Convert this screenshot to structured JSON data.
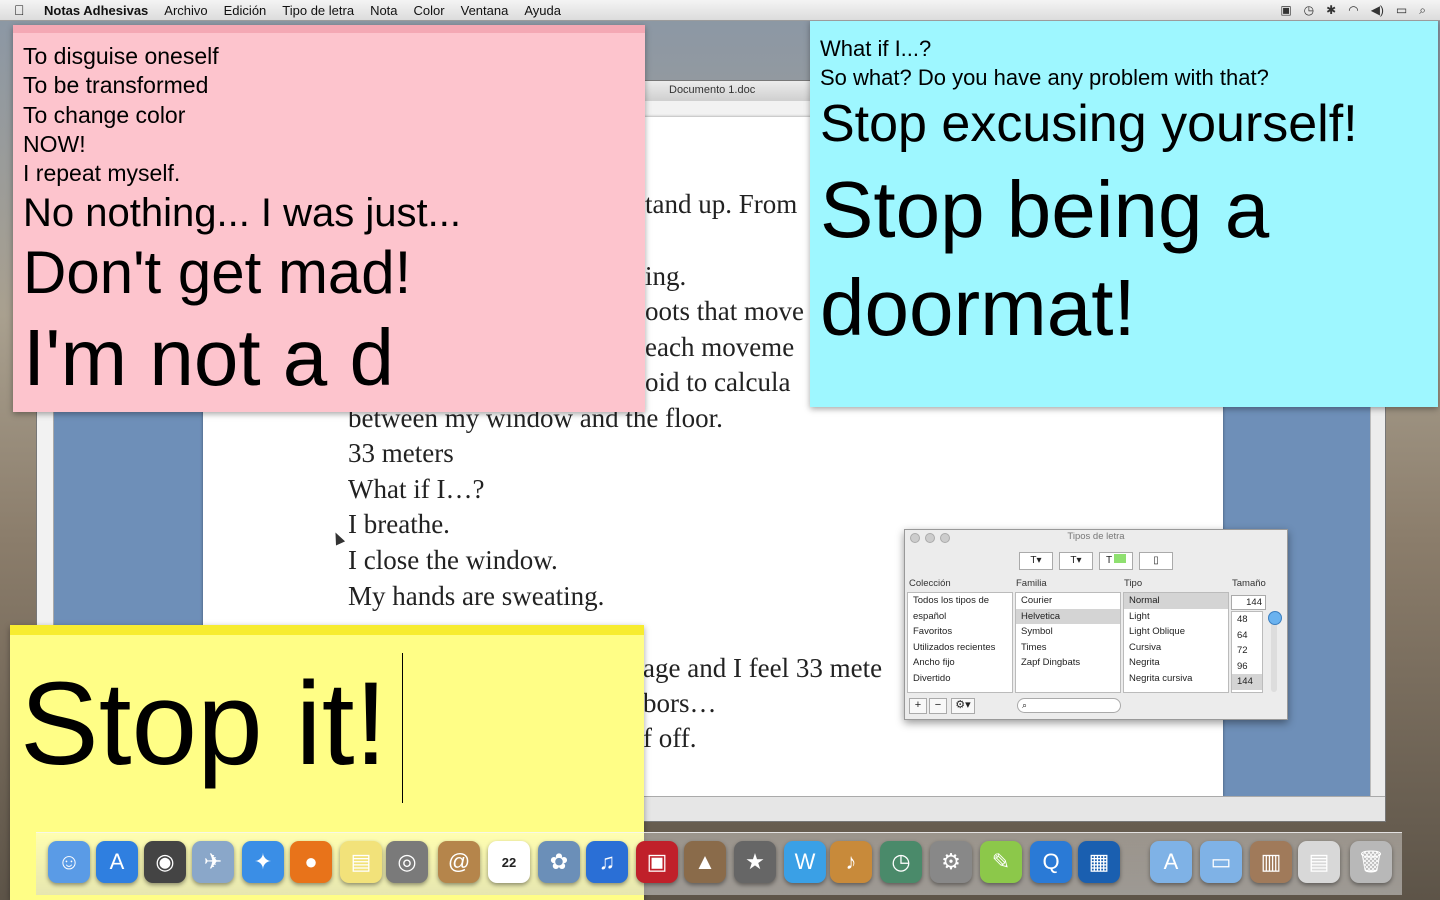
{
  "menubar": {
    "app_name": "Notas Adhesivas",
    "items": [
      "Archivo",
      "Edición",
      "Tipo de letra",
      "Nota",
      "Color",
      "Ventana",
      "Ayuda"
    ]
  },
  "document": {
    "title": "Documento 1.doc",
    "lines": [
      "tand up. From",
      "ing.",
      "oots that move",
      "each moveme",
      "oid to calcula",
      "between my window and the floor.",
      "33 meters",
      "What if I…?",
      "I breathe.",
      "I close the window.",
      "My hands are sweating.",
      "age and I feel 33 mete",
      "bors…",
      "f off."
    ]
  },
  "sticky_pink": {
    "lines": [
      "To disguise oneself",
      "To be transformed",
      "To change color",
      "NOW!",
      "I repeat myself.",
      "No nothing... I was just...",
      "Don't get mad!",
      "I'm not a d"
    ]
  },
  "sticky_blue": {
    "lines": [
      "What if I...?",
      "So what? Do you have any problem with that?",
      "Stop excusing yourself!",
      "Stop being a",
      "doormat!"
    ]
  },
  "sticky_yellow": {
    "text": "Stop it!"
  },
  "font_panel": {
    "title": "Tipos de letra",
    "headers": {
      "collection": "Colección",
      "family": "Familia",
      "typeface": "Tipo",
      "size": "Tamaño"
    },
    "collections": [
      "Todos los tipos de",
      "español",
      "Favoritos",
      "Utilizados recientes",
      "Ancho fijo",
      "Divertido"
    ],
    "families": [
      "Courier",
      "Helvetica",
      "Symbol",
      "Times",
      "Zapf Dingbats"
    ],
    "selected_family": "Helvetica",
    "typefaces": [
      "Normal",
      "Light",
      "Light Oblique",
      "Cursiva",
      "Negrita",
      "Negrita cursiva"
    ],
    "selected_typeface": "Normal",
    "size_value": "144",
    "sizes": [
      "48",
      "64",
      "72",
      "96",
      "144"
    ],
    "add_label": "+",
    "remove_label": "−",
    "gear_label": "⚙▾"
  },
  "dock": {
    "icons": [
      {
        "name": "finder-icon",
        "glyph": "☺",
        "color": "#5a9be6"
      },
      {
        "name": "app-store-icon",
        "glyph": "A",
        "color": "#2f7fe0"
      },
      {
        "name": "dashboard-icon",
        "glyph": "◉",
        "color": "#444444"
      },
      {
        "name": "preview-icon",
        "glyph": "✈",
        "color": "#8aa7c9"
      },
      {
        "name": "safari-icon",
        "glyph": "✦",
        "color": "#3a8ee6"
      },
      {
        "name": "firefox-icon",
        "glyph": "●",
        "color": "#e8731a"
      },
      {
        "name": "stickies-icon",
        "glyph": "▤",
        "color": "#f2e27a"
      },
      {
        "name": "facetime-icon",
        "glyph": "◎",
        "color": "#7a7a7a"
      },
      {
        "name": "address-book-icon",
        "glyph": "@",
        "color": "#b5854b"
      },
      {
        "name": "ical-icon",
        "glyph": "22",
        "color": "#ffffff"
      },
      {
        "name": "iphoto-icon",
        "glyph": "✿",
        "color": "#6b8fb8"
      },
      {
        "name": "itunes-icon",
        "glyph": "♫",
        "color": "#2a6fd6"
      },
      {
        "name": "photo-booth-icon",
        "glyph": "▣",
        "color": "#c0202a"
      },
      {
        "name": "image-capture-icon",
        "glyph": "▲",
        "color": "#8a6b4a"
      },
      {
        "name": "imovie-icon",
        "glyph": "★",
        "color": "#666666"
      },
      {
        "name": "iweb-icon",
        "glyph": "W",
        "color": "#3aa0e6"
      },
      {
        "name": "garageband-icon",
        "glyph": "♪",
        "color": "#c88a3a"
      },
      {
        "name": "time-machine-icon",
        "glyph": "◷",
        "color": "#4a8a6a"
      },
      {
        "name": "system-preferences-icon",
        "glyph": "⚙",
        "color": "#888888"
      },
      {
        "name": "textedit-icon",
        "glyph": "✎",
        "color": "#8cc84a"
      },
      {
        "name": "quicktime-icon",
        "glyph": "Q",
        "color": "#2a7ad6"
      },
      {
        "name": "screen-recorder-icon",
        "glyph": "▦",
        "color": "#1a5fb0"
      },
      {
        "name": "applications-folder-icon",
        "glyph": "A",
        "color": "#7fb2e6"
      },
      {
        "name": "documents-folder-icon",
        "glyph": "▭",
        "color": "#7fb2e6"
      },
      {
        "name": "downloads-stack-icon",
        "glyph": "▥",
        "color": "#a07a5a"
      },
      {
        "name": "documents-stack-icon",
        "glyph": "▤",
        "color": "#d8d8d8"
      },
      {
        "name": "trash-icon",
        "glyph": "🗑",
        "color": "#b8b8b8"
      }
    ]
  }
}
